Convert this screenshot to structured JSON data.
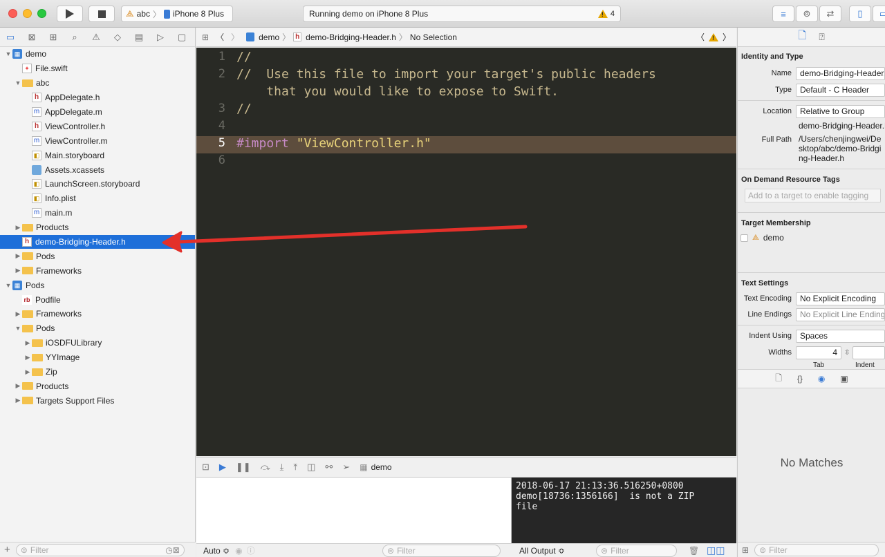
{
  "toolbar": {
    "scheme_target": "abc",
    "scheme_device": "iPhone 8 Plus",
    "activity_text": "Running demo on iPhone 8 Plus",
    "warning_count": "4"
  },
  "navigator": {
    "filter_placeholder": "Filter",
    "tree": [
      {
        "label": "demo",
        "type": "project",
        "depth": 0,
        "disclosure": "open"
      },
      {
        "label": "File.swift",
        "type": "swift",
        "depth": 1
      },
      {
        "label": "abc",
        "type": "folder",
        "depth": 1,
        "disclosure": "open"
      },
      {
        "label": "AppDelegate.h",
        "type": "h",
        "depth": 2
      },
      {
        "label": "AppDelegate.m",
        "type": "m",
        "depth": 2
      },
      {
        "label": "ViewController.h",
        "type": "h",
        "depth": 2
      },
      {
        "label": "ViewController.m",
        "type": "m",
        "depth": 2
      },
      {
        "label": "Main.storyboard",
        "type": "gen",
        "depth": 2
      },
      {
        "label": "Assets.xcassets",
        "type": "assets",
        "depth": 2
      },
      {
        "label": "LaunchScreen.storyboard",
        "type": "gen",
        "depth": 2
      },
      {
        "label": "Info.plist",
        "type": "gen",
        "depth": 2
      },
      {
        "label": "main.m",
        "type": "m",
        "depth": 2
      },
      {
        "label": "Products",
        "type": "folder",
        "depth": 1,
        "disclosure": "closed"
      },
      {
        "label": "demo-Bridging-Header.h",
        "type": "h",
        "depth": 1,
        "selected": true
      },
      {
        "label": "Pods",
        "type": "folder",
        "depth": 1,
        "disclosure": "closed"
      },
      {
        "label": "Frameworks",
        "type": "folder",
        "depth": 1,
        "disclosure": "closed"
      },
      {
        "label": "Pods",
        "type": "project",
        "depth": 0,
        "disclosure": "open"
      },
      {
        "label": "Podfile",
        "type": "rb",
        "depth": 1
      },
      {
        "label": "Frameworks",
        "type": "folder",
        "depth": 1,
        "disclosure": "closed"
      },
      {
        "label": "Pods",
        "type": "folder",
        "depth": 1,
        "disclosure": "open"
      },
      {
        "label": "iOSDFULibrary",
        "type": "folder",
        "depth": 2,
        "disclosure": "closed"
      },
      {
        "label": "YYImage",
        "type": "folder",
        "depth": 2,
        "disclosure": "closed"
      },
      {
        "label": "Zip",
        "type": "folder",
        "depth": 2,
        "disclosure": "closed"
      },
      {
        "label": "Products",
        "type": "folder",
        "depth": 1,
        "disclosure": "closed"
      },
      {
        "label": "Targets Support Files",
        "type": "folder",
        "depth": 1,
        "disclosure": "closed"
      }
    ]
  },
  "jumpbar": {
    "project": "demo",
    "file": "demo-Bridging-Header.h",
    "selection": "No Selection"
  },
  "editor": {
    "lines": [
      {
        "num": "1",
        "text": "//"
      },
      {
        "num": "2",
        "text": "//  Use this file to import your target's public headers"
      },
      {
        "num": "",
        "text": "    that you would like to expose to Swift."
      },
      {
        "num": "3",
        "text": "//"
      },
      {
        "num": "4",
        "text": ""
      },
      {
        "num": "5",
        "text": "#import \"ViewController.h\"",
        "highlight": true
      },
      {
        "num": "6",
        "text": ""
      }
    ],
    "import_keyword": "#import",
    "import_string": "\"ViewController.h\""
  },
  "debug": {
    "target": "demo",
    "console_text": "2018-06-17 21:13:36.516250+0800\ndemo[18736:1356166]  is not a ZIP\nfile",
    "auto_label": "Auto ≎",
    "filter_placeholder": "Filter",
    "output_label": "All Output ≎"
  },
  "inspector": {
    "identity_title": "Identity and Type",
    "name_label": "Name",
    "name_value": "demo-Bridging-Header.h",
    "type_label": "Type",
    "type_value": "Default - C Header",
    "location_label": "Location",
    "location_value": "Relative to Group",
    "location_path": "demo-Bridging-Header.h",
    "fullpath_label": "Full Path",
    "fullpath_value": "/Users/chenjingwei/Desktop/abc/demo-Bridging-Header.h",
    "odr_title": "On Demand Resource Tags",
    "odr_placeholder": "Add to a target to enable tagging",
    "membership_title": "Target Membership",
    "membership_target": "demo",
    "text_settings_title": "Text Settings",
    "encoding_label": "Text Encoding",
    "encoding_value": "No Explicit Encoding",
    "endings_label": "Line Endings",
    "endings_value": "No Explicit Line Endings",
    "indent_label": "Indent Using",
    "indent_value": "Spaces",
    "widths_label": "Widths",
    "tab_width": "4",
    "tab_label": "Tab",
    "indent_sub_label": "Indent",
    "no_matches": "No Matches",
    "filter_placeholder": "Filter"
  },
  "colors": {
    "selection": "#1e6fd9",
    "annotation_arrow": "#e3302a",
    "editor_bg": "#292a25"
  }
}
